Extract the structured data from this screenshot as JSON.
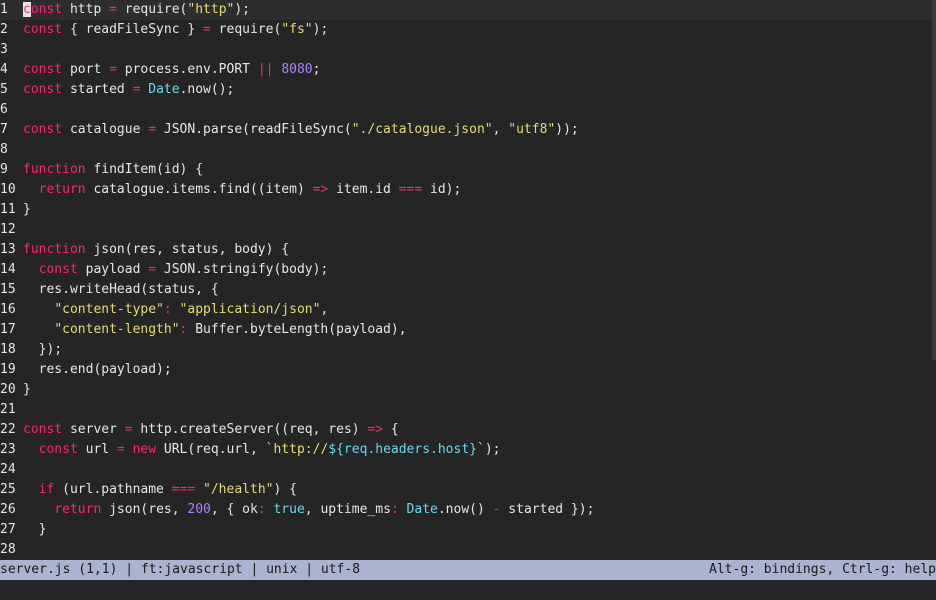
{
  "colors": {
    "background": "#252526",
    "keyword": "#f92672",
    "string": "#e6db74",
    "number": "#ae81ff",
    "type": "#66d9ef",
    "text": "#e6e6e6",
    "statusbar": "#aab4d0"
  },
  "editor": {
    "cursor": {
      "line": 1,
      "column": 1
    },
    "lines": [
      {
        "n": "1",
        "tokens": [
          [
            "kw",
            "const"
          ],
          [
            "plain",
            " http "
          ],
          [
            "op",
            "="
          ],
          [
            "plain",
            " require("
          ],
          [
            "str",
            "\"http\""
          ],
          [
            "plain",
            ");"
          ]
        ]
      },
      {
        "n": "2",
        "tokens": [
          [
            "kw",
            "const"
          ],
          [
            "plain",
            " { readFileSync } "
          ],
          [
            "op",
            "="
          ],
          [
            "plain",
            " require("
          ],
          [
            "str",
            "\"fs\""
          ],
          [
            "plain",
            ");"
          ]
        ]
      },
      {
        "n": "3",
        "tokens": []
      },
      {
        "n": "4",
        "tokens": [
          [
            "kw",
            "const"
          ],
          [
            "plain",
            " port "
          ],
          [
            "op",
            "="
          ],
          [
            "plain",
            " process.env.PORT "
          ],
          [
            "op",
            "||"
          ],
          [
            "plain",
            " "
          ],
          [
            "num",
            "8080"
          ],
          [
            "plain",
            ";"
          ]
        ]
      },
      {
        "n": "5",
        "tokens": [
          [
            "kw",
            "const"
          ],
          [
            "plain",
            " started "
          ],
          [
            "op",
            "="
          ],
          [
            "plain",
            " "
          ],
          [
            "type",
            "Date"
          ],
          [
            "plain",
            ".now();"
          ]
        ]
      },
      {
        "n": "6",
        "tokens": []
      },
      {
        "n": "7",
        "tokens": [
          [
            "kw",
            "const"
          ],
          [
            "plain",
            " catalogue "
          ],
          [
            "op",
            "="
          ],
          [
            "plain",
            " JSON.parse(readFileSync("
          ],
          [
            "str",
            "\"./catalogue.json\""
          ],
          [
            "plain",
            ", "
          ],
          [
            "str",
            "\"utf8\""
          ],
          [
            "plain",
            "));"
          ]
        ]
      },
      {
        "n": "8",
        "tokens": []
      },
      {
        "n": "9",
        "tokens": [
          [
            "kw",
            "function"
          ],
          [
            "plain",
            " findItem(id) {"
          ]
        ]
      },
      {
        "n": "10",
        "tokens": [
          [
            "plain",
            "  "
          ],
          [
            "kw",
            "return"
          ],
          [
            "plain",
            " catalogue.items.find((item) "
          ],
          [
            "op",
            "=>"
          ],
          [
            "plain",
            " item.id "
          ],
          [
            "op",
            "==="
          ],
          [
            "plain",
            " id);"
          ]
        ]
      },
      {
        "n": "11",
        "tokens": [
          [
            "plain",
            "}"
          ]
        ]
      },
      {
        "n": "12",
        "tokens": []
      },
      {
        "n": "13",
        "tokens": [
          [
            "kw",
            "function"
          ],
          [
            "plain",
            " json(res, status, body) {"
          ]
        ]
      },
      {
        "n": "14",
        "tokens": [
          [
            "plain",
            "  "
          ],
          [
            "kw",
            "const"
          ],
          [
            "plain",
            " payload "
          ],
          [
            "op",
            "="
          ],
          [
            "plain",
            " JSON.stringify(body);"
          ]
        ]
      },
      {
        "n": "15",
        "tokens": [
          [
            "plain",
            "  res.writeHead(status, {"
          ]
        ]
      },
      {
        "n": "16",
        "tokens": [
          [
            "plain",
            "    "
          ],
          [
            "str",
            "\"content-type\""
          ],
          [
            "op",
            ":"
          ],
          [
            "plain",
            " "
          ],
          [
            "str",
            "\"application/json\""
          ],
          [
            "plain",
            ","
          ]
        ]
      },
      {
        "n": "17",
        "tokens": [
          [
            "plain",
            "    "
          ],
          [
            "str",
            "\"content-length\""
          ],
          [
            "op",
            ":"
          ],
          [
            "plain",
            " Buffer.byteLength(payload),"
          ]
        ]
      },
      {
        "n": "18",
        "tokens": [
          [
            "plain",
            "  });"
          ]
        ]
      },
      {
        "n": "19",
        "tokens": [
          [
            "plain",
            "  res.end(payload);"
          ]
        ]
      },
      {
        "n": "20",
        "tokens": [
          [
            "plain",
            "}"
          ]
        ]
      },
      {
        "n": "21",
        "tokens": []
      },
      {
        "n": "22",
        "tokens": [
          [
            "kw",
            "const"
          ],
          [
            "plain",
            " server "
          ],
          [
            "op",
            "="
          ],
          [
            "plain",
            " http.createServer((req, res) "
          ],
          [
            "op",
            "=>"
          ],
          [
            "plain",
            " {"
          ]
        ]
      },
      {
        "n": "23",
        "tokens": [
          [
            "plain",
            "  "
          ],
          [
            "kw",
            "const"
          ],
          [
            "plain",
            " url "
          ],
          [
            "op",
            "="
          ],
          [
            "plain",
            " "
          ],
          [
            "kw",
            "new"
          ],
          [
            "plain",
            " URL(req.url, "
          ],
          [
            "str",
            "`http://"
          ],
          [
            "interp",
            "${req.headers.host}"
          ],
          [
            "str",
            "`"
          ],
          [
            "plain",
            ");"
          ]
        ]
      },
      {
        "n": "24",
        "tokens": []
      },
      {
        "n": "25",
        "tokens": [
          [
            "plain",
            "  "
          ],
          [
            "kw",
            "if"
          ],
          [
            "plain",
            " (url.pathname "
          ],
          [
            "op",
            "==="
          ],
          [
            "plain",
            " "
          ],
          [
            "str",
            "\"/health\""
          ],
          [
            "plain",
            ") {"
          ]
        ]
      },
      {
        "n": "26",
        "tokens": [
          [
            "plain",
            "    "
          ],
          [
            "kw",
            "return"
          ],
          [
            "plain",
            " json(res, "
          ],
          [
            "num",
            "200"
          ],
          [
            "plain",
            ", { "
          ],
          [
            "plain",
            "ok"
          ],
          [
            "op",
            ":"
          ],
          [
            "plain",
            " "
          ],
          [
            "type",
            "true"
          ],
          [
            "plain",
            ", uptime_ms"
          ],
          [
            "op",
            ":"
          ],
          [
            "plain",
            " "
          ],
          [
            "type",
            "Date"
          ],
          [
            "plain",
            ".now() "
          ],
          [
            "op",
            "-"
          ],
          [
            "plain",
            " started });"
          ]
        ]
      },
      {
        "n": "27",
        "tokens": [
          [
            "plain",
            "  }"
          ]
        ]
      },
      {
        "n": "28",
        "tokens": []
      }
    ]
  },
  "statusbar": {
    "left": "server.js (1,1) | ft:javascript | unix | utf-8",
    "right": "Alt-g: bindings, Ctrl-g: help"
  }
}
